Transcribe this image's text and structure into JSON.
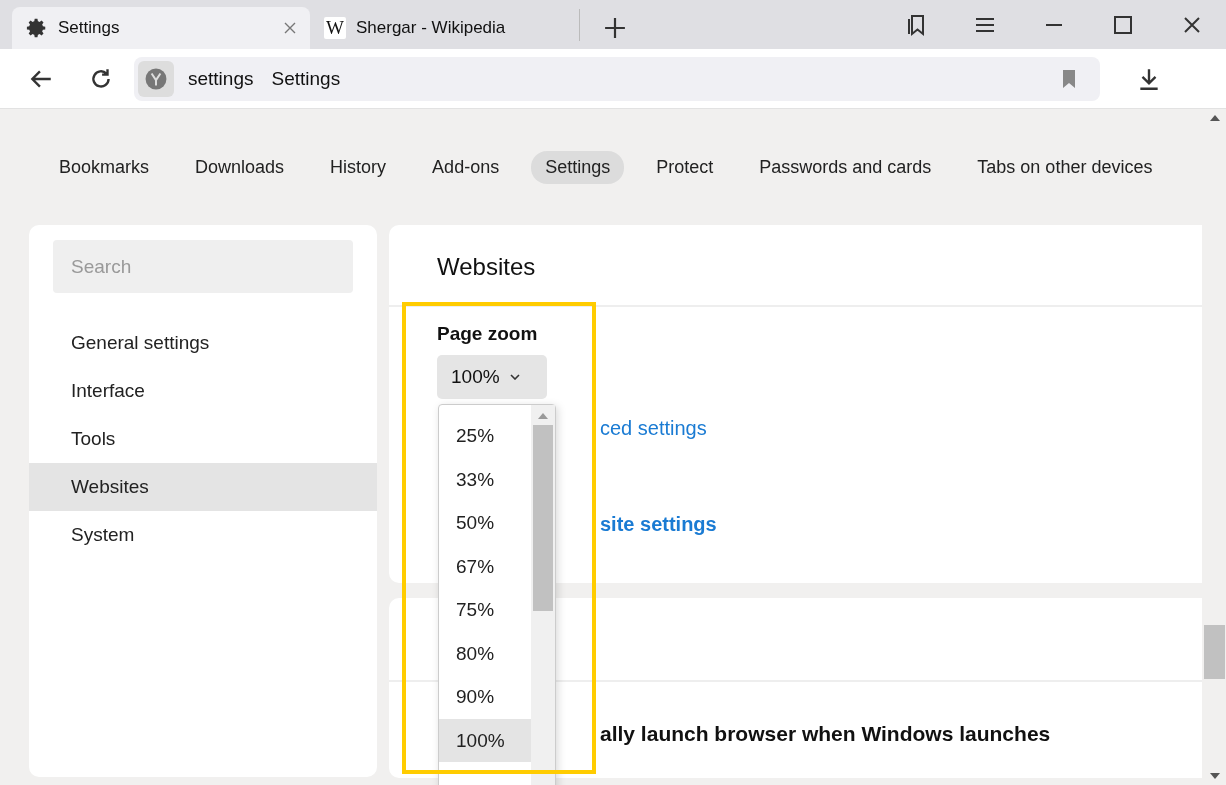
{
  "browser_tabs": [
    {
      "title": "Settings",
      "selected": true,
      "kind": "settings"
    },
    {
      "title": "Shergar - Wikipedia",
      "selected": false,
      "kind": "site",
      "favicon": "W"
    }
  ],
  "address_bar": {
    "host": "settings",
    "title": "Settings"
  },
  "nav_tabs": [
    {
      "label": "Bookmarks",
      "selected": false
    },
    {
      "label": "Downloads",
      "selected": false
    },
    {
      "label": "History",
      "selected": false
    },
    {
      "label": "Add-ons",
      "selected": false
    },
    {
      "label": "Settings",
      "selected": true
    },
    {
      "label": "Protect",
      "selected": false
    },
    {
      "label": "Passwords and cards",
      "selected": false
    },
    {
      "label": "Tabs on other devices",
      "selected": false
    }
  ],
  "sidebar": {
    "search": {
      "placeholder": "Search"
    },
    "items": [
      {
        "label": "General settings",
        "selected": false
      },
      {
        "label": "Interface",
        "selected": false
      },
      {
        "label": "Tools",
        "selected": false
      },
      {
        "label": "Websites",
        "selected": true
      },
      {
        "label": "System",
        "selected": false
      }
    ]
  },
  "websites": {
    "heading": "Websites",
    "page_zoom": {
      "label": "Page zoom",
      "value": "100%",
      "options": [
        {
          "label": "25%",
          "selected": false
        },
        {
          "label": "33%",
          "selected": false
        },
        {
          "label": "50%",
          "selected": false
        },
        {
          "label": "67%",
          "selected": false
        },
        {
          "label": "75%",
          "selected": false
        },
        {
          "label": "80%",
          "selected": false
        },
        {
          "label": "90%",
          "selected": false
        },
        {
          "label": "100%",
          "selected": true
        }
      ]
    },
    "links": [
      "ced settings",
      "site settings"
    ]
  },
  "startup": {
    "option": "ally launch browser when Windows launches"
  }
}
